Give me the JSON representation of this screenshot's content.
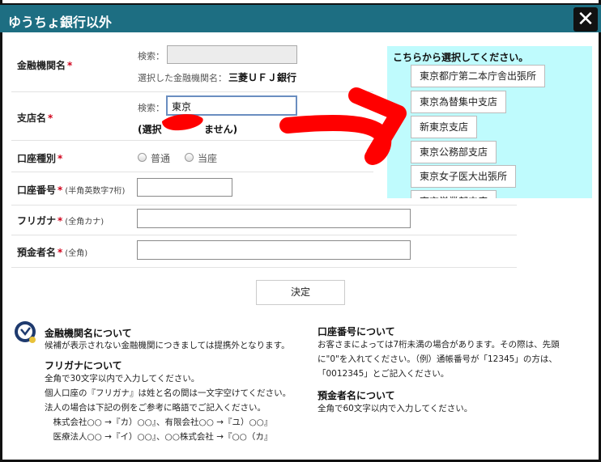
{
  "dialog": {
    "title": "ゆうちょ銀行以外",
    "close_icon": "close-icon"
  },
  "form": {
    "bank": {
      "label": "金融機関名",
      "required_mark": "*",
      "search_prefix": "検索：",
      "search_value": "",
      "selected_prefix": "選択した金融機関名：",
      "selected_value": "三菱ＵＦＪ銀行"
    },
    "branch": {
      "label": "支店名",
      "required_mark": "*",
      "search_prefix": "検索：",
      "search_value": "東京",
      "status_left": "(選択",
      "status_right": "ません)"
    },
    "account_type": {
      "label": "口座種別",
      "required_mark": "*",
      "options": [
        "普通",
        "当座"
      ]
    },
    "account_number": {
      "label": "口座番号",
      "required_mark": "*",
      "note": "(半角英数字7桁)",
      "value": ""
    },
    "furigana": {
      "label": "フリガナ",
      "required_mark": "*",
      "note": "(全角カナ)",
      "value": ""
    },
    "holder": {
      "label": "預金者名",
      "required_mark": "*",
      "note": "(全角)",
      "value": ""
    },
    "submit_label": "決定"
  },
  "branch_panel": {
    "title": "こちらから選択してください。",
    "items": [
      "東京都庁第二本庁舎出張所",
      "東京為替集中支店",
      "新東京支店",
      "東京公務部支店",
      "東京女子医大出張所",
      "東京営業部支店"
    ]
  },
  "info": {
    "bank_heading": "金融機関名について",
    "bank_text": "候補が表示されない金融機関につきましては提携外となります。",
    "furigana_heading": "フリガナについて",
    "furigana_lines": [
      "全角で30文字以内で入力してください。",
      "個人口座の『フリガナ』は姓と名の間は一文字空けてください。",
      "法人の場合は下記の例をご参考に略語でご記入ください。",
      "　株式会社○○ →『カ）○○』、有限会社○○ →『ユ）○○』",
      "　医療法人○○ →『イ）○○』、○○株式会社 →『○○（カ』"
    ],
    "number_heading": "口座番号について",
    "number_lines": [
      "お客さまによっては7桁未満の場合があります。その際は、先頭",
      "に\"0\"を入れてください。（例）通帳番号が「12345」の方は、",
      "「0012345」とご記入ください。"
    ],
    "holder_heading": "預金者名について",
    "holder_text": "全角で60文字以内で入力してください。"
  },
  "colors": {
    "titlebar": "#1d6e82",
    "panel_bg": "#bffbfd",
    "required": "#d0021b",
    "annotation": "#ff0000"
  }
}
